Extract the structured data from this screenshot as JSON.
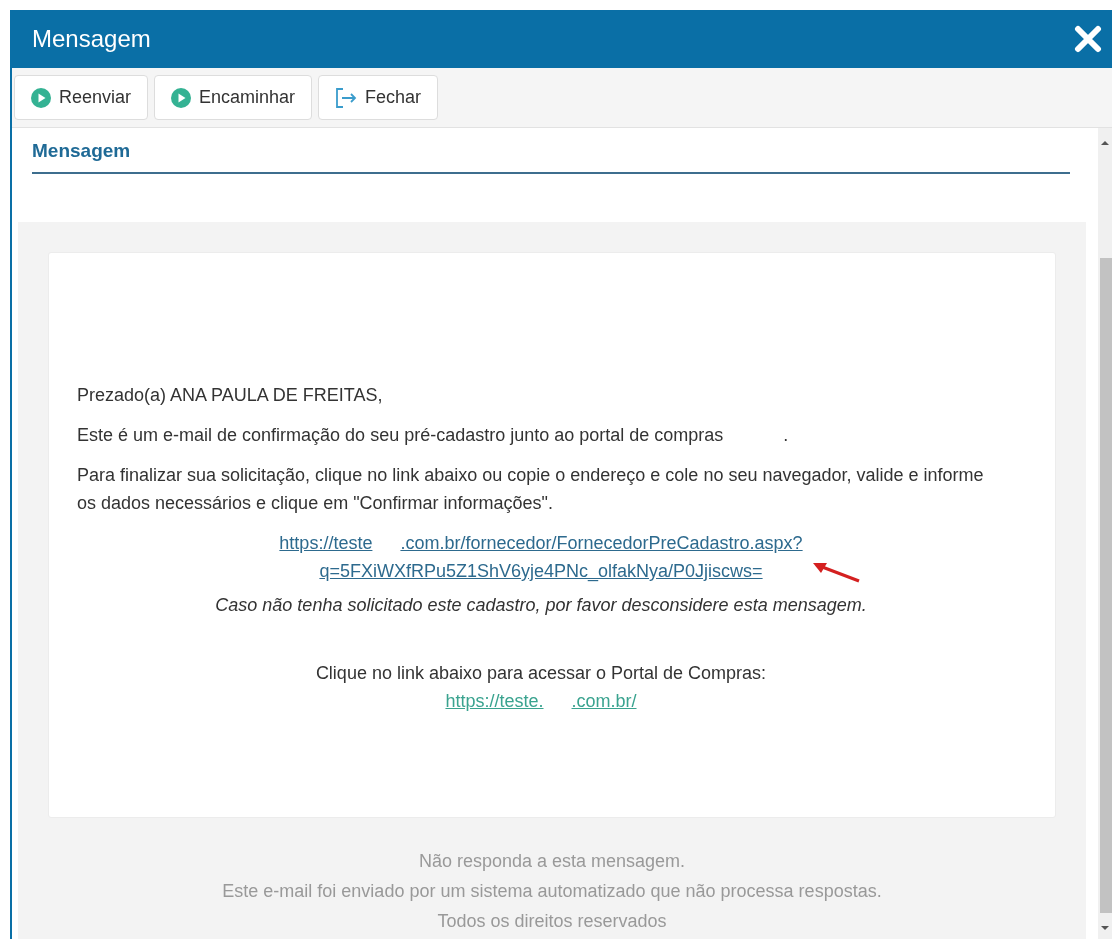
{
  "window": {
    "title": "Mensagem"
  },
  "toolbar": [
    {
      "label": "Reenviar",
      "kind": "play"
    },
    {
      "label": "Encaminhar",
      "kind": "play"
    },
    {
      "label": "Fechar",
      "kind": "exit"
    }
  ],
  "section": {
    "title": "Mensagem"
  },
  "email": {
    "greeting": "Prezado(a) ANA PAULA DE FREITAS,",
    "intro": [
      "Este é um e-mail de confirmação do seu pré-cadastro junto ao portal de compras",
      "."
    ],
    "instructions": "Para finalizar sua solicitação, clique no link abaixo ou copie o endereço e cole no seu navegador, valide e informe os dados necessários e clique em \"Confirmar informações\".",
    "link_lines": [
      [
        "https://teste",
        ".com.br/fornecedor/FornecedorPreCadastro.aspx?"
      ],
      [
        "q=5FXiWXfRPu5Z1ShV6yje4PNc_olfakNya/P0Jjiscws="
      ]
    ],
    "disclaimer": "Caso não tenha solicitado este cadastro, por favor desconsidere esta mensagem.",
    "portal_prompt": "Clique no link abaixo para acessar o Portal de Compras:",
    "portal_link": [
      "https://teste.",
      ".com.br/"
    ]
  },
  "footer": [
    "Não responda a esta mensagem.",
    "Este e-mail foi enviado por um sistema automatizado que não processa respostas.",
    "Todos os direitos reservados"
  ]
}
